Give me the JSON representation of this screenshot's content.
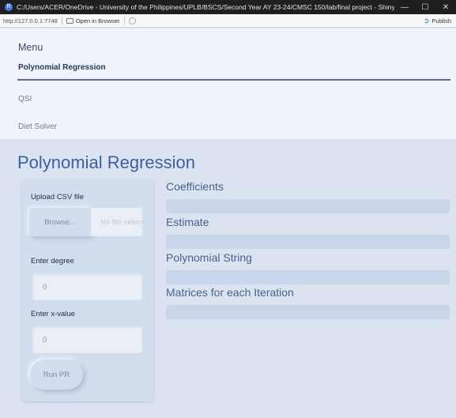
{
  "window": {
    "app_icon": "R",
    "title": "C:/Users/ACER/OneDrive - University of the Philippines/UPLB/BSCS/Second Year AY 23-24/CMSC 150/lab/final project - Shiny",
    "controls": {
      "minimize": "—",
      "maximize": "☐",
      "close": "✕"
    }
  },
  "toolbar": {
    "url": "http://127.0.0.1:7748",
    "open_in_browser": "Open in Browser",
    "publish": "Publish"
  },
  "nav": {
    "header": "Menu",
    "items": [
      {
        "label": "Polynomial Regression",
        "active": true
      },
      {
        "label": "QSI",
        "active": false
      },
      {
        "label": "Diet Solver",
        "active": false
      }
    ]
  },
  "page": {
    "title": "Polynomial Regression"
  },
  "sidebar": {
    "upload_label": "Upload CSV file",
    "browse_label": "Browse...",
    "file_placeholder": "No file selected",
    "degree_label": "Enter degree",
    "degree_value": "0",
    "xvalue_label": "Enter x-value",
    "xvalue_value": "0",
    "run_label": "Run PR"
  },
  "outputs": {
    "coefficients": "Coefficients",
    "estimate": "Estimate",
    "poly_string": "Polynomial String",
    "matrices": "Matrices for each Iteration"
  },
  "colors": {
    "accent": "#3b5fa0",
    "background": "#dbe3f0",
    "panel": "#d2ddee",
    "nav_background": "#f0f3fa"
  }
}
